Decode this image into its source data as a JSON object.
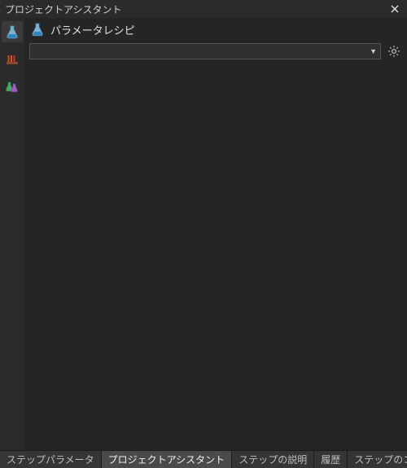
{
  "titlebar": {
    "title": "プロジェクトアシスタント"
  },
  "left_rail": {
    "items": [
      {
        "name": "flask-icon",
        "active": true
      },
      {
        "name": "rack-icon",
        "active": false
      },
      {
        "name": "beakers-icon",
        "active": false
      }
    ]
  },
  "header": {
    "title": "パラメータレシピ"
  },
  "dropdown": {
    "selected": ""
  },
  "bottom_tabs": [
    {
      "label": "ステップパラメータ",
      "active": false
    },
    {
      "label": "プロジェクトアシスタント",
      "active": true
    },
    {
      "label": "ステップの説明",
      "active": false
    },
    {
      "label": "履歴",
      "active": false
    },
    {
      "label": "ステップのコメント",
      "active": false
    }
  ]
}
